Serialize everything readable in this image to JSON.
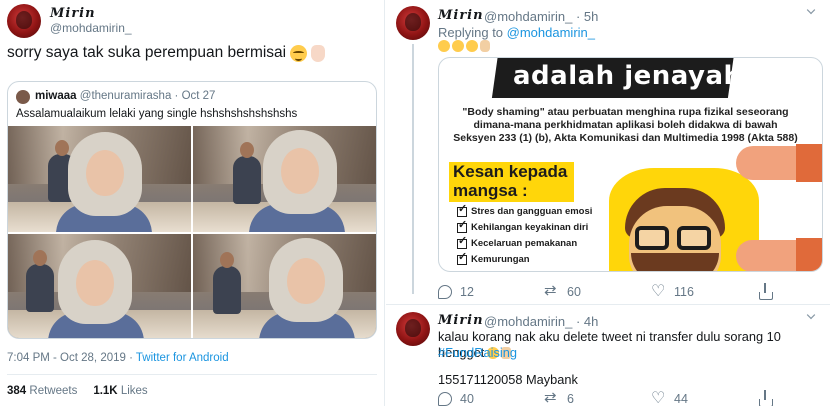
{
  "left_tweet": {
    "author_name": "Mirin",
    "author_handle": "@mohdamirin_",
    "text": "sorry saya tak suka perempuan bermisai",
    "quoted": {
      "author_name": "miwaaa",
      "author_handle": "@thenuramirasha · Oct 27",
      "text": "Assalamualaikum lelaki yang single hshshshshshshshs"
    },
    "timestamp": "7:04 PM - Oct 28, 2019 · ",
    "source": "Twitter for Android",
    "retweets_count": "384",
    "retweets_label": "Retweets",
    "likes_count": "1.1K",
    "likes_label": "Likes"
  },
  "right_thread": {
    "tweet1": {
      "author_name": "Mirin",
      "author_handle": "@mohdamirin_ · 5h",
      "replying_prefix": "Replying to ",
      "replying_to": "@mohdamirin_",
      "poster": {
        "title": "adalah jenayah",
        "body": "\"Body shaming\" atau perbuatan menghina rupa fizikal seseorang dimana-mana perkhidmatan aplikasi boleh didakwa di bawah Seksyen 233 (1) (b), Akta Komunikasi dan Multimedia 1998 (Akta 588)",
        "kesan_title": "Kesan kepada mangsa :",
        "effects": [
          "Stres dan gangguan emosi",
          "Kehilangan keyakinan diri",
          "Kecelaruan pemakanan",
          "Kemurungan"
        ]
      },
      "replies": "12",
      "retweets": "60",
      "likes": "116"
    },
    "tweet2": {
      "author_name": "Mirin",
      "author_handle": "@mohdamirin_ · 4h",
      "text": "kalau korang nak aku delete tweet ni transfer dulu sorang 10 hengget",
      "hashtag": "#FundRaising",
      "account_line": "155171120058 Maybank",
      "replies": "40",
      "retweets": "6",
      "likes": "44"
    }
  },
  "colors": {
    "link": "#1b95e0",
    "muted": "#657786",
    "poster_yellow": "#ffd60a"
  }
}
